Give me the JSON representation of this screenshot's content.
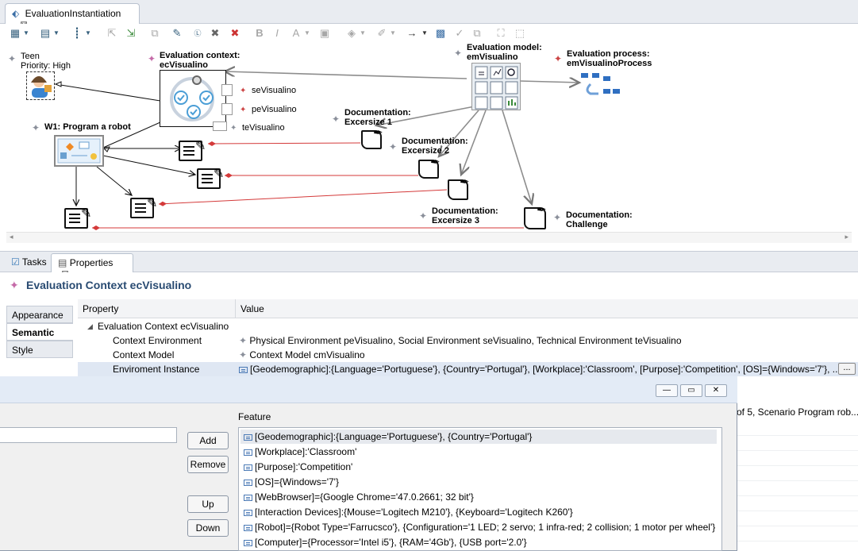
{
  "editor": {
    "tab_label": "EvaluationInstantiation",
    "close_glyph": "⊠"
  },
  "diagram": {
    "teen": {
      "name": "Teen",
      "priority": "Priority: High"
    },
    "context": {
      "line1": "Evaluation context:",
      "line2": "ecVisualino"
    },
    "environments": [
      "seVisualino",
      "peVisualino",
      "teVisualino"
    ],
    "model": {
      "line1": "Evaluation model:",
      "line2": "emVisualino"
    },
    "process": {
      "line1": "Evaluation process:",
      "line2": "emVisualinoProcess"
    },
    "workshop": "W1: Program a robot",
    "docs": [
      {
        "line1": "Documentation:",
        "line2": "Excersize 1"
      },
      {
        "line1": "Documentation:",
        "line2": "Excersize 2"
      },
      {
        "line1": "Documentation:",
        "line2": "Excersize 3"
      },
      {
        "line1": "Documentation:",
        "line2": "Challenge"
      }
    ]
  },
  "views": {
    "tasks": "Tasks",
    "properties": "Properties"
  },
  "properties": {
    "title": "Evaluation Context ecVisualino",
    "tabs": [
      "Appearance",
      "Semantic",
      "Style"
    ],
    "selected_tab": "Semantic",
    "columns": [
      "Property",
      "Value"
    ],
    "group": "Evaluation Context ecVisualino",
    "rows": [
      {
        "property": "Context Environment",
        "value": "Physical Environment peVisualino, Social Environment seVisualino, Technical Environment teVisualino"
      },
      {
        "property": "Context Model",
        "value": "Context Model cmVisualino"
      },
      {
        "property": "Enviroment Instance",
        "value": "[Geodemographic]:{Language='Portuguese'}, {Country='Portugal'}, [Workplace]:'Classroom', [Purpose]:'Competition', [OS]={Windows='7'}, ..."
      }
    ],
    "ellipsis_button": "..."
  },
  "background_text": "of 5, Scenario Program rob...",
  "dialog": {
    "window_buttons": [
      "—",
      "▭",
      "✕"
    ],
    "buttons": {
      "add": "Add",
      "remove": "Remove",
      "up": "Up",
      "down": "Down"
    },
    "feature_label": "Feature",
    "features": [
      "[Geodemographic]:{Language='Portuguese'}, {Country='Portugal'}",
      "[Workplace]:'Classroom'",
      "[Purpose]:'Competition'",
      "[OS]={Windows='7'}",
      "[WebBrowser]={Google Chrome='47.0.2661; 32 bit'}",
      "[Interaction Devices]:{Mouse='Logitech M210'}, {Keyboard='Logitech K260'}",
      "[Robot]={Robot Type='Farrucsco'}, {Configuration='1 LED; 2 servo; 1 infra-red; 2 collision; 1 motor per wheel'}",
      "[Computer]={Processor='Intel i5'}, {RAM='4Gb'}, {USB port='2.0'}"
    ],
    "selected_feature_index": 0
  },
  "colors": {
    "accent": "#294b72",
    "link_red": "#d43a3a",
    "arrow_gray": "#8d8d8d"
  }
}
